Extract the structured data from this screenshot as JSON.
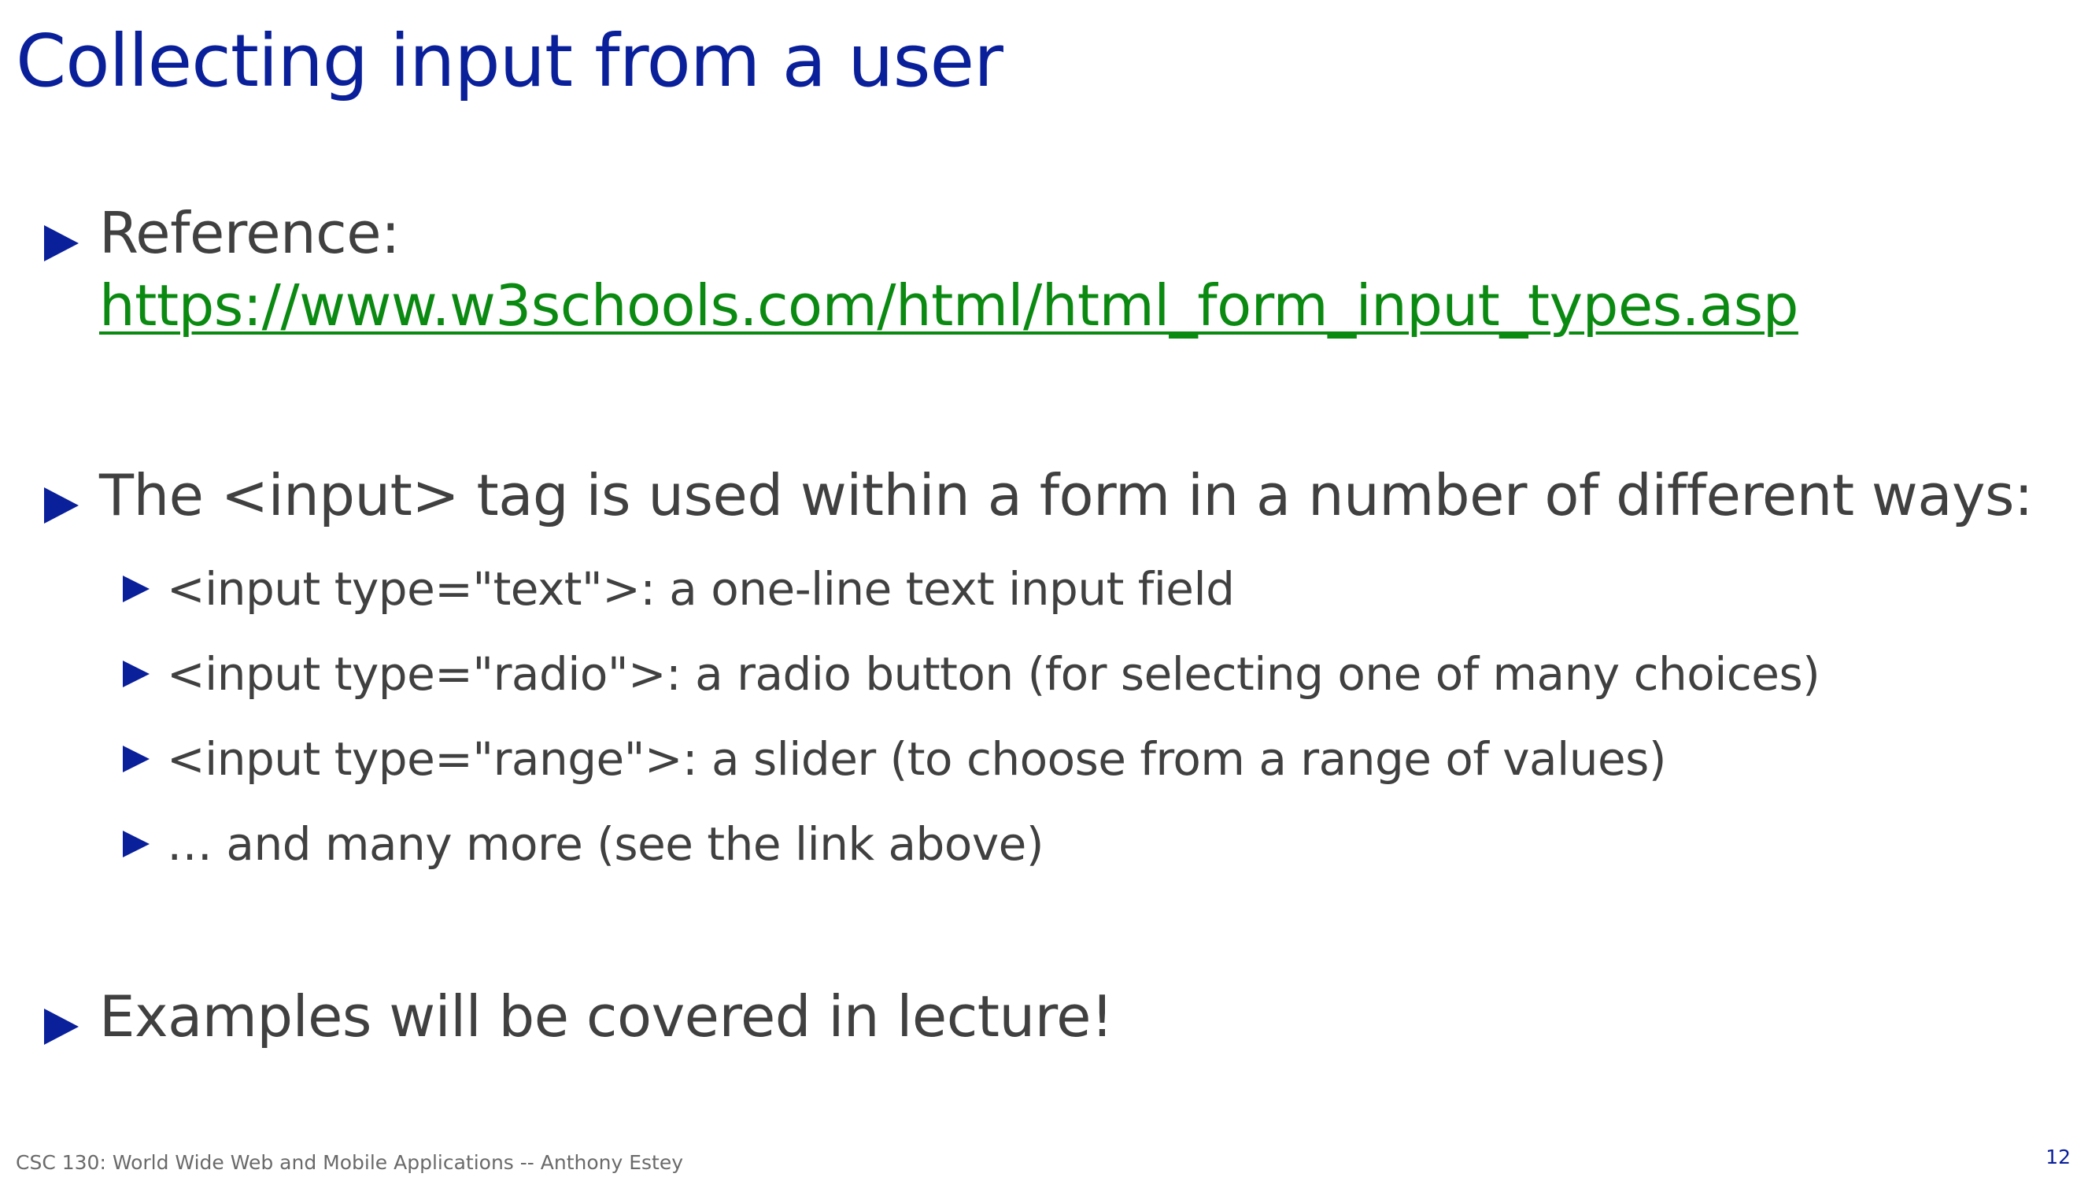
{
  "slide": {
    "title": "Collecting input from a user",
    "bullets": [
      {
        "label": "Reference:",
        "link": "https://www.w3schools.com/html/html_form_input_types.asp"
      },
      {
        "label": "The <input> tag is used within a form in a number of different ways:",
        "sub_items": [
          "<input type=\"text\">: a one-line text input field",
          "<input type=\"radio\">: a radio button (for selecting one of many choices)",
          "<input type=\"range\">: a slider (to choose from a range of values)",
          "… and many more (see the link above)"
        ]
      },
      {
        "label": "Examples will be covered in lecture!"
      }
    ]
  },
  "footer": {
    "course": "CSC 130: World Wide Web and Mobile Applications -- Anthony Estey",
    "page_number": "12"
  },
  "colors": {
    "title": "#0a1f9a",
    "bullet": "#0a1f9a",
    "body_text": "#404040",
    "link": "#0b8a12",
    "footer": "#6a6a6a"
  },
  "icons": {
    "bullet": "triangle-right-icon"
  }
}
